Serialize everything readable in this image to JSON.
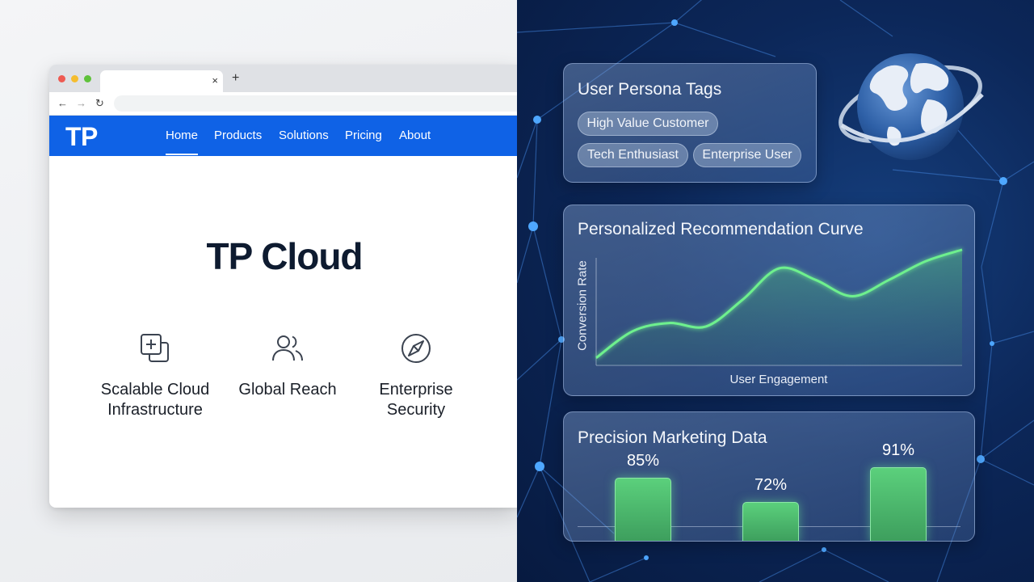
{
  "browser": {
    "tab_close": "×",
    "new_tab": "+",
    "back": "←",
    "forward": "→",
    "reload": "↻"
  },
  "site": {
    "logo": "TP",
    "nav": [
      "Home",
      "Products",
      "Solutions",
      "Pricing",
      "About"
    ],
    "active_nav": "Home",
    "hero_title": "TP Cloud",
    "features": [
      {
        "icon": "plus-square-stack-icon",
        "line1": "Scalable Cloud",
        "line2": "Infrastructure"
      },
      {
        "icon": "users-icon",
        "line1": "Global Reach",
        "line2": ""
      },
      {
        "icon": "compass-icon",
        "line1": "Enterprise",
        "line2": "Security"
      }
    ],
    "brand_color": "#0f62e6"
  },
  "persona": {
    "title": "User Persona Tags",
    "tags": [
      "High Value Customer",
      "Tech Enthusiast",
      "Enterprise User"
    ]
  },
  "curve": {
    "title": "Personalized Recommendation Curve",
    "ylabel": "Conversion Rate",
    "xlabel": "User Engagement",
    "line_color": "#6ef08e"
  },
  "marketing": {
    "title": "Precision Marketing Data",
    "bar_color": "#5bd07c"
  },
  "chart_data": [
    {
      "type": "line",
      "title": "Personalized Recommendation Curve",
      "xlabel": "User Engagement",
      "ylabel": "Conversion Rate",
      "x": [
        0,
        1,
        2,
        3,
        4,
        5,
        6,
        7,
        8,
        9,
        10
      ],
      "values": [
        0.05,
        0.28,
        0.35,
        0.32,
        0.55,
        0.82,
        0.72,
        0.58,
        0.72,
        0.88,
        0.98
      ],
      "grid": false
    },
    {
      "type": "bar",
      "title": "Precision Marketing Data",
      "categories": [
        "",
        "",
        ""
      ],
      "values": [
        85,
        72,
        91
      ],
      "value_labels": [
        "85%",
        "72%",
        "91%"
      ],
      "ylim": [
        0,
        100
      ]
    }
  ]
}
